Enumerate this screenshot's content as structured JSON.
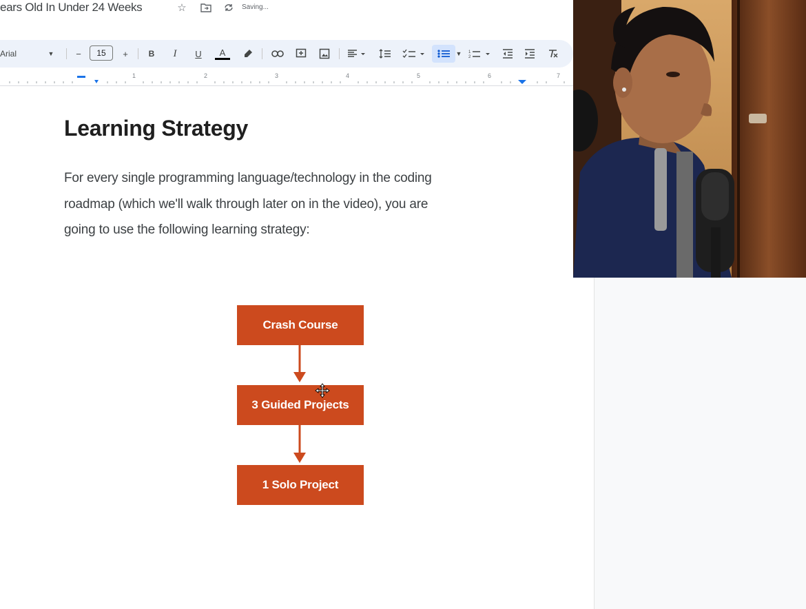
{
  "title_bar": {
    "doc_title": "ears Old In Under 24 Weeks",
    "status": "Saving..."
  },
  "toolbar": {
    "font_name": "Arial",
    "font_size": "15",
    "minus": "−",
    "plus": "+",
    "bold": "B",
    "italic": "I",
    "underline": "U",
    "text_color": "A"
  },
  "ruler": {
    "marks": [
      "1",
      "2",
      "3",
      "4",
      "5",
      "6",
      "7"
    ]
  },
  "document": {
    "heading": "Learning Strategy",
    "paragraph_lines": [
      "For every single programming language/technology in the coding",
      "roadmap (which we'll walk through later on in the video), you are",
      "going to use the following learning strategy:"
    ]
  },
  "diagram": {
    "steps": [
      "Crash Course",
      "3 Guided Projects",
      "1 Solo Project"
    ],
    "color": "#cc4a1e"
  },
  "colors": {
    "toolbar_bg": "#edf2fa",
    "accent": "#cc4a1e",
    "active_button": "#d3e3fd"
  }
}
